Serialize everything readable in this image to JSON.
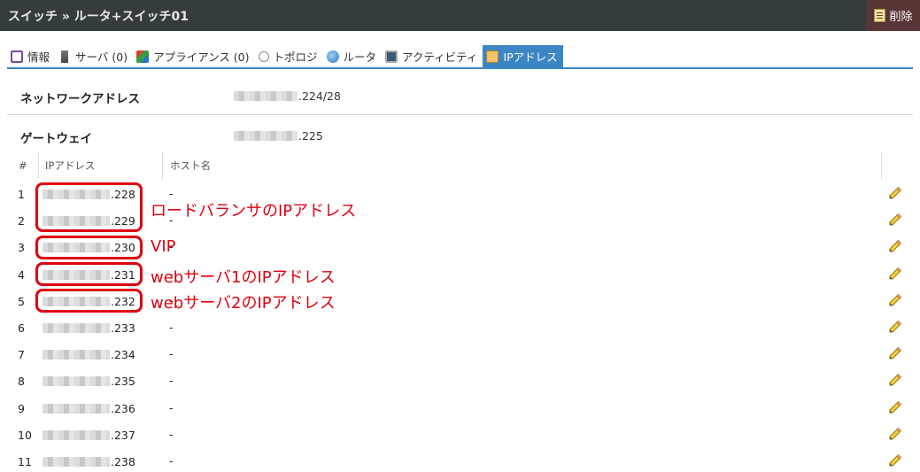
{
  "header": {
    "breadcrumb": "スイッチ » ルータ+スイッチ01",
    "delete_label": "削除"
  },
  "tabs": [
    {
      "label": "情報",
      "icon": "info-icon"
    },
    {
      "label": "サーバ (0)",
      "icon": "server-icon"
    },
    {
      "label": "アプライアンス (0)",
      "icon": "appliance-icon"
    },
    {
      "label": "トポロジ",
      "icon": "topology-icon"
    },
    {
      "label": "ルータ",
      "icon": "router-icon"
    },
    {
      "label": "アクティビティ",
      "icon": "activity-icon"
    },
    {
      "label": "IPアドレス",
      "icon": "ip-address-icon",
      "active": true
    }
  ],
  "info": {
    "network_label": "ネットワークアドレス",
    "network_value": ".224/28",
    "gateway_label": "ゲートウェイ",
    "gateway_value": ".225"
  },
  "table": {
    "columns": [
      "#",
      "IPアドレス",
      "ホスト名"
    ],
    "rows": [
      {
        "num": "1",
        "ip": ".228",
        "host": "-"
      },
      {
        "num": "2",
        "ip": ".229",
        "host": "-"
      },
      {
        "num": "3",
        "ip": ".230",
        "host": "-"
      },
      {
        "num": "4",
        "ip": ".231",
        "host": "-"
      },
      {
        "num": "5",
        "ip": ".232",
        "host": "-"
      },
      {
        "num": "6",
        "ip": ".233",
        "host": "-"
      },
      {
        "num": "7",
        "ip": ".234",
        "host": "-"
      },
      {
        "num": "8",
        "ip": ".235",
        "host": "-"
      },
      {
        "num": "9",
        "ip": ".236",
        "host": "-"
      },
      {
        "num": "10",
        "ip": ".237",
        "host": "-"
      },
      {
        "num": "11",
        "ip": ".238",
        "host": "-"
      }
    ]
  },
  "annotations": {
    "lb": "ロードバランサのIPアドレス",
    "vip": "VIP",
    "web1": "webサーバ1のIPアドレス",
    "web2": "webサーバ2のIPアドレス"
  },
  "colors": {
    "topbar": "#353c3e",
    "accent": "#3d86c6",
    "annotation": "#e0000f"
  }
}
